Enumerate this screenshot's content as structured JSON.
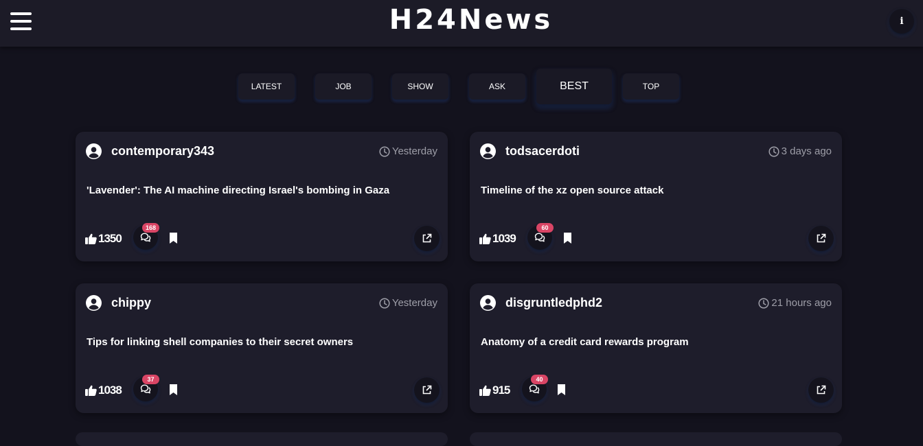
{
  "header": {
    "title": "H24News",
    "menu_icon": "hamburger-menu-icon",
    "info_label": "i"
  },
  "tabs": [
    {
      "label": "LATEST",
      "active": false
    },
    {
      "label": "JOB",
      "active": false
    },
    {
      "label": "SHOW",
      "active": false
    },
    {
      "label": "ASK",
      "active": false
    },
    {
      "label": "BEST",
      "active": true
    },
    {
      "label": "TOP",
      "active": false
    }
  ],
  "posts": [
    {
      "user": "contemporary343",
      "time": "Yesterday",
      "title": "'Lavender': The AI machine directing Israel's bombing in Gaza",
      "likes": "1350",
      "comments": "168"
    },
    {
      "user": "todsacerdoti",
      "time": "3 days ago",
      "title": "Timeline of the xz open source attack",
      "likes": "1039",
      "comments": "60"
    },
    {
      "user": "chippy",
      "time": "Yesterday",
      "title": "Tips for linking shell companies to their secret owners",
      "likes": "1038",
      "comments": "37"
    },
    {
      "user": "disgruntledphd2",
      "time": "21 hours ago",
      "title": "Anatomy of a credit card rewards program",
      "likes": "915",
      "comments": "40"
    }
  ],
  "icons": {
    "user": "user-circle-icon",
    "clock": "clock-icon",
    "like": "thumbs-up-icon",
    "comment": "comments-icon",
    "bookmark": "bookmark-icon",
    "open": "external-link-icon"
  },
  "colors": {
    "background": "#13121d",
    "card": "#1e1d2b",
    "badge": "#d94565",
    "accent_glow": "#4678f0"
  }
}
